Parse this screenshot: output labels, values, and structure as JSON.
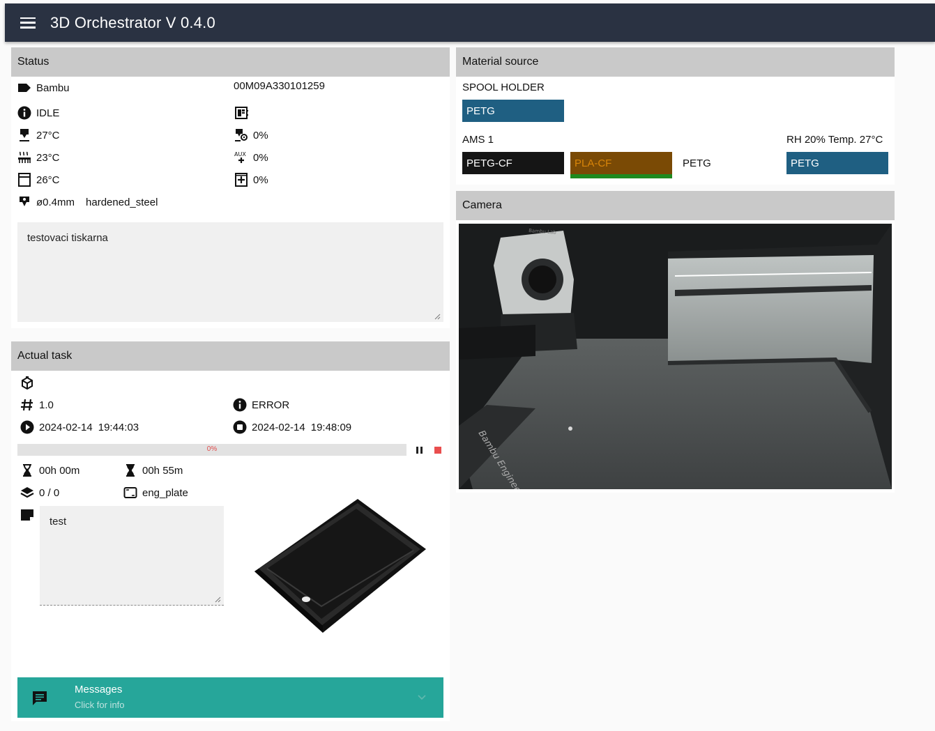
{
  "app": {
    "title": "3D Orchestrator V 0.4.0"
  },
  "status": {
    "heading": "Status",
    "brand": "Bambu",
    "serial": "00M09A330101259",
    "state": "IDLE",
    "nozzle_temp": "27°C",
    "bed_temp": "23°C",
    "chamber_temp": "26°C",
    "part_fan": "0%",
    "aux_fan": "0%",
    "chamber_fan": "0%",
    "nozzle_diameter": "ø0.4mm",
    "nozzle_type": "hardened_steel",
    "note": "testovaci tiskarna"
  },
  "task": {
    "heading": "Actual task",
    "number": "1.0",
    "state": "ERROR",
    "start_date": "2024-02-14",
    "start_time": "19:44:03",
    "end_date": "2024-02-14",
    "end_time": "19:48:09",
    "progress_label": "0%",
    "progress": 0,
    "elapsed": "00h 00m",
    "remaining": "00h 55m",
    "layers": "0 / 0",
    "plate": "eng_plate",
    "note": "test"
  },
  "messages": {
    "title": "Messages",
    "subtitle": "Click for info"
  },
  "material": {
    "heading": "Material source",
    "spool_label": "SPOOL HOLDER",
    "spool_material": "PETG",
    "spool_color": "#1f5f82",
    "ams_label": "AMS 1",
    "ams_env": "RH 20%  Temp. 27°C",
    "slots": [
      {
        "material": "PETG-CF",
        "color": "#151515",
        "text_color": "#ffffff"
      },
      {
        "material": "PLA-CF",
        "color": "#7a4a05",
        "text_color": "#d8850a",
        "underline": "#1e8a1e"
      },
      {
        "material": "PETG",
        "color": "#ffffff",
        "text_color": "#111111"
      },
      {
        "material": "PETG",
        "color": "#1f5f82",
        "text_color": "#ffffff"
      }
    ]
  },
  "camera": {
    "heading": "Camera",
    "logo_text": "Bambu Lab",
    "plate_text": "Bambu Engineering Pl"
  },
  "colors": {
    "appbar": "#2a3242",
    "card_header": "#c9c9c9",
    "messages": "#26a69a"
  }
}
